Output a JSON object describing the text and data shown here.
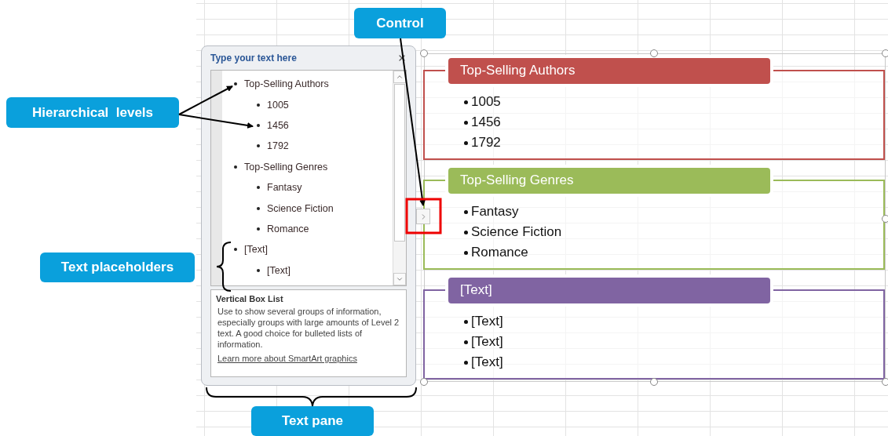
{
  "callouts": [
    {
      "label": "Control"
    },
    {
      "label": "Hierarchical  levels"
    },
    {
      "label": "Text placeholders"
    },
    {
      "label": "Text pane"
    }
  ],
  "text_pane": {
    "title": "Type your text here",
    "items": [
      {
        "text": "Top-Selling Authors",
        "children": [
          {
            "text": "1005"
          },
          {
            "text": "1456"
          },
          {
            "text": "1792"
          }
        ]
      },
      {
        "text": "Top-Selling Genres",
        "children": [
          {
            "text": "Fantasy"
          },
          {
            "text": "Science Fiction"
          },
          {
            "text": "Romance"
          }
        ]
      },
      {
        "text": "[Text]",
        "children": [
          {
            "text": "[Text]"
          }
        ]
      }
    ],
    "description": {
      "title": "Vertical Box List",
      "body": "Use to show several groups of information, especially groups with large amounts of Level 2 text. A good choice for bulleted lists of information.",
      "link": "Learn more about SmartArt graphics"
    }
  },
  "smartart": {
    "groups": [
      {
        "title": "Top-Selling Authors",
        "color": "#c0504d",
        "items": [
          "1005",
          "1456",
          "1792"
        ]
      },
      {
        "title": "Top-Selling Genres",
        "color": "#9bbb59",
        "items": [
          "Fantasy",
          "Science Fiction",
          "Romance"
        ]
      },
      {
        "title": "[Text]",
        "color": "#8064a2",
        "items": [
          "[Text]",
          "[Text]",
          "[Text]"
        ]
      }
    ]
  }
}
